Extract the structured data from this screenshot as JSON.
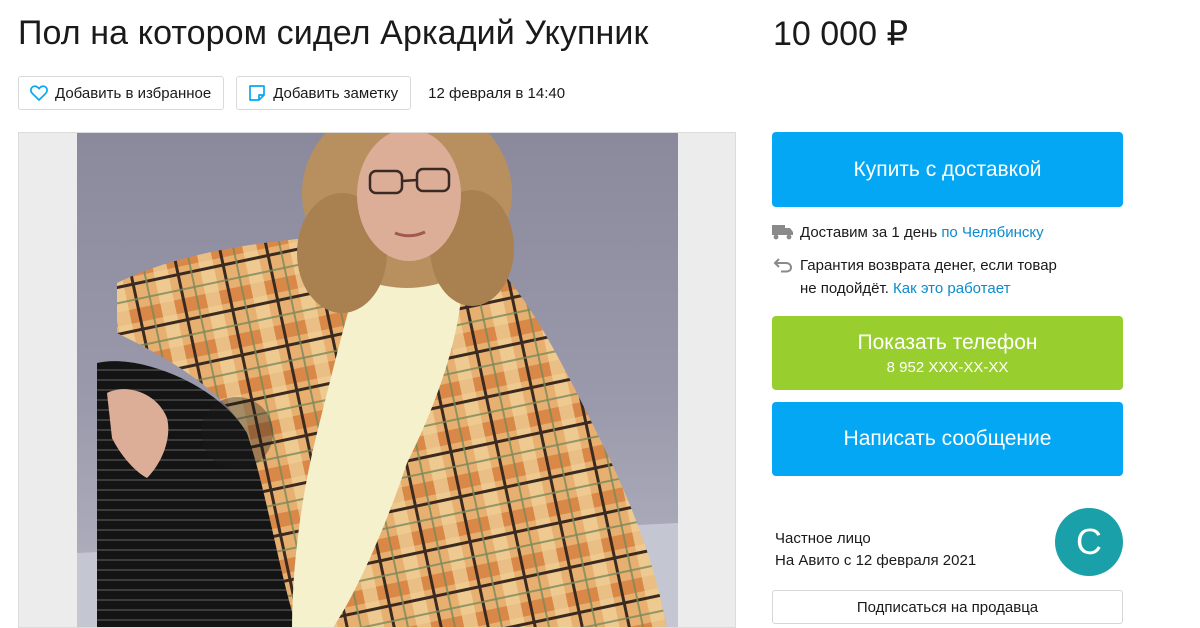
{
  "listing": {
    "title": "Пол на котором сидел Аркадий Укупник",
    "price": "10 000 ₽",
    "date": "12 февраля в 14:40"
  },
  "actions": {
    "favorite_label": "Добавить в избранное",
    "note_label": "Добавить заметку"
  },
  "buy": {
    "label": "Купить с доставкой"
  },
  "delivery": {
    "text": "Доставим за 1 день",
    "link": "по Челябинску",
    "icon": "truck-icon"
  },
  "guarantee": {
    "line1": "Гарантия возврата денег, если товар",
    "line2": "не подойдёт.",
    "link": "Как это работает",
    "icon": "return-arrow-icon"
  },
  "phone": {
    "label": "Показать телефон",
    "number": "8 952 XXX-XX-XX"
  },
  "message": {
    "label": "Написать сообщение"
  },
  "seller": {
    "type": "Частное лицо",
    "since": "На Авито с 12 февраля 2021",
    "avatar_letter": "С",
    "subscribe_label": "Подписаться на продавца"
  },
  "colors": {
    "blue_cta": "#04a7f4",
    "green_cta": "#98cf2e",
    "link": "#0a8ccf",
    "avatar": "#1aa0a8"
  }
}
